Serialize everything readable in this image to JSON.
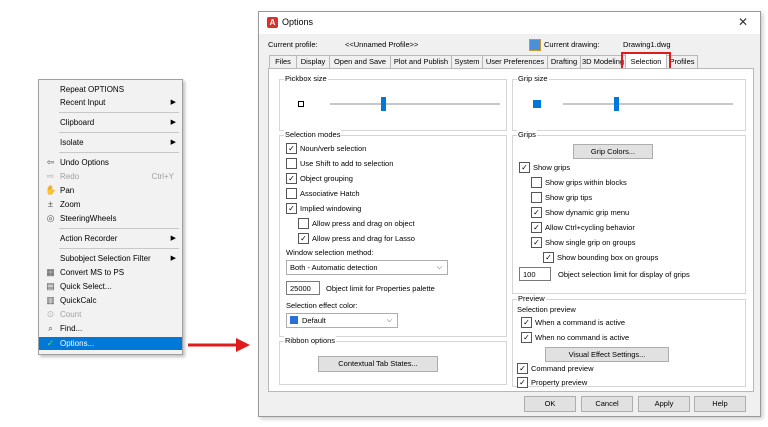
{
  "context_menu": {
    "repeat_options": "Repeat OPTIONS",
    "recent_input": "Recent Input",
    "clipboard": "Clipboard",
    "isolate": "Isolate",
    "undo_options": "Undo Options",
    "redo": "Redo",
    "redo_shortcut": "Ctrl+Y",
    "pan": "Pan",
    "zoom": "Zoom",
    "steering_wheels": "SteeringWheels",
    "action_recorder": "Action Recorder",
    "subobject_filter": "Subobject Selection Filter",
    "convert_ms_ps": "Convert MS to PS",
    "quick_select": "Quick Select...",
    "quickcalc": "QuickCalc",
    "count": "Count",
    "find": "Find...",
    "options": "Options..."
  },
  "dialog": {
    "title": "Options",
    "current_profile_label": "Current profile:",
    "current_profile_value": "<<Unnamed Profile>>",
    "current_drawing_label": "Current drawing:",
    "current_drawing_value": "Drawing1.dwg",
    "tabs": [
      "Files",
      "Display",
      "Open and Save",
      "Plot and Publish",
      "System",
      "User Preferences",
      "Drafting",
      "3D Modeling",
      "Selection",
      "Profiles"
    ],
    "pickbox": {
      "title": "Pickbox size",
      "level": 0.3
    },
    "grip_size": {
      "title": "Grip size",
      "level": 0.3
    },
    "selection_modes": {
      "title": "Selection modes",
      "noun_verb": "Noun/verb selection",
      "use_shift": "Use Shift to add to selection",
      "object_grouping": "Object grouping",
      "associative_hatch": "Associative Hatch",
      "implied_windowing": "Implied windowing",
      "allow_press_drag_object": "Allow press and drag on object",
      "allow_press_drag_lasso": "Allow press and drag for Lasso",
      "window_method_label": "Window selection method:",
      "window_method_value": "Both - Automatic detection",
      "object_limit_value": "25000",
      "object_limit_label": "Object limit for Properties palette",
      "effect_color_label": "Selection effect color:",
      "effect_color_value": "Default",
      "effect_color_swatch": "#2a6fd6"
    },
    "ribbon": {
      "title": "Ribbon options",
      "button": "Contextual Tab States..."
    },
    "grips": {
      "title": "Grips",
      "grip_colors_button": "Grip Colors...",
      "show_grips": "Show grips",
      "show_grips_blocks": "Show grips within blocks",
      "show_grip_tips": "Show grip tips",
      "show_dynamic_menu": "Show dynamic grip menu",
      "allow_ctrl_cycling": "Allow Ctrl+cycling behavior",
      "show_single_grip": "Show single grip on groups",
      "show_bounding_box": "Show bounding box on groups",
      "grip_limit_value": "100",
      "grip_limit_label": "Object selection limit for display of grips"
    },
    "preview": {
      "title": "Preview",
      "selection_preview": "Selection preview",
      "when_command_active": "When a command is active",
      "when_no_command": "When no command is active",
      "visual_effects_button": "Visual Effect Settings...",
      "command_preview": "Command preview",
      "property_preview": "Property preview"
    },
    "buttons": {
      "ok": "OK",
      "cancel": "Cancel",
      "apply": "Apply",
      "help": "Help"
    }
  },
  "colors": {
    "accent": "#0078d7",
    "highlight_box": "#e01b1b",
    "arrow": "#e01b1b"
  }
}
